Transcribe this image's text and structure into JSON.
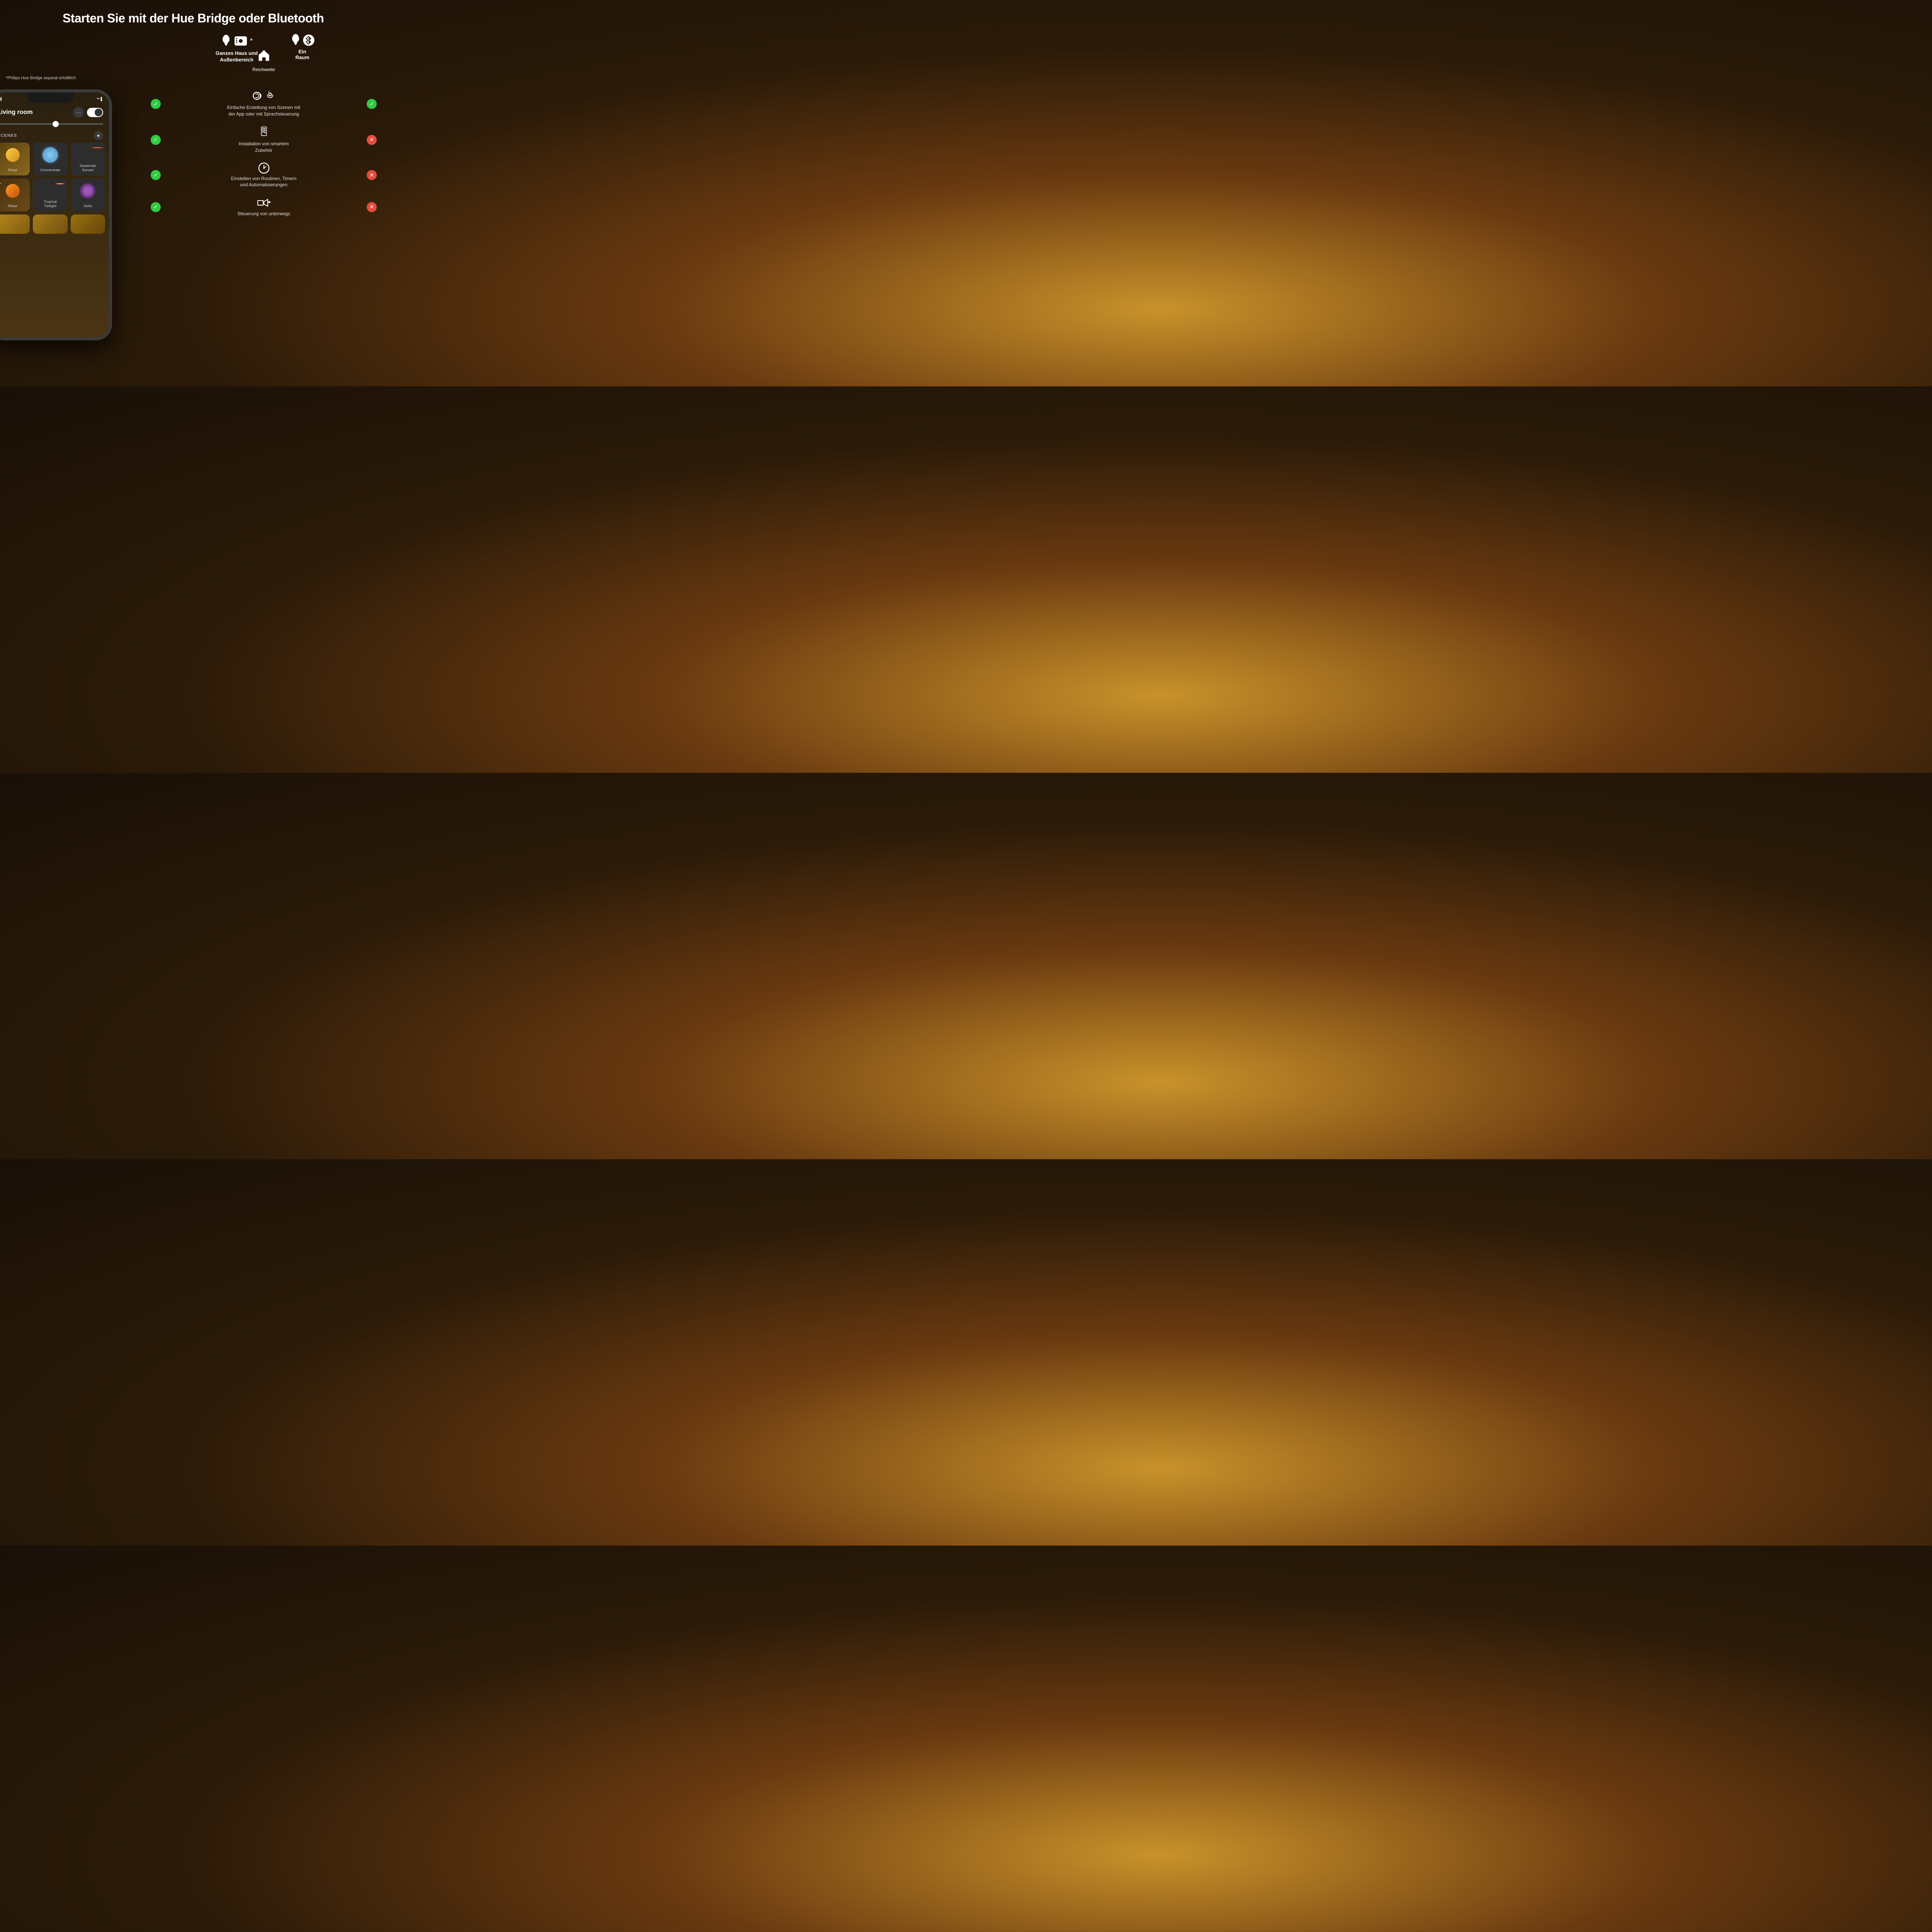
{
  "page": {
    "title": "Starten Sie mit der Hue Bridge oder Bluetooth",
    "background": "dark-warm-gradient"
  },
  "bridge_section": {
    "lamp_asterisk": "*",
    "label_line1": "Ganzes Haus und",
    "label_line2": "Außenbereich"
  },
  "range_section": {
    "label": "Reichweite"
  },
  "bluetooth_section": {
    "label_line1": "Ein",
    "label_line2": "Raum"
  },
  "phone_note": "*Philips Hue Bridge separat erhältlich",
  "app": {
    "room_name": "Living room",
    "dots_label": "•••",
    "scenes_header": "SCENES",
    "scenes": [
      {
        "id": "read",
        "label": "Read",
        "color_type": "warm-gold"
      },
      {
        "id": "concentrate",
        "label": "Concentrate",
        "color_type": "cyan-rings"
      },
      {
        "id": "savannah-sunset",
        "label": "Savannah\nSunset",
        "color_type": "sunset"
      },
      {
        "id": "relax",
        "label": "Relax",
        "color_type": "warm-orange"
      },
      {
        "id": "tropical-twilight",
        "label": "Tropical\nTwilight",
        "color_type": "tropical"
      },
      {
        "id": "soho",
        "label": "Soho",
        "color_type": "soho"
      }
    ]
  },
  "features": [
    {
      "id": "scenes",
      "icon": "voice-nfc",
      "text": "Einfache Erstellung von Szenen mit\nder App oder mit Sprachsteuerung",
      "bridge_supported": true,
      "bt_supported": true
    },
    {
      "id": "accessories",
      "icon": "smart-accessory",
      "text": "Installation von smartem\nZubehör",
      "bridge_supported": true,
      "bt_supported": false
    },
    {
      "id": "routines",
      "icon": "clock",
      "text": "Einstellen von Routinen, Timern\nund Automatisierungen",
      "bridge_supported": true,
      "bt_supported": false
    },
    {
      "id": "remote",
      "icon": "remote-control",
      "text": "Steuerung von unterwegs",
      "bridge_supported": true,
      "bt_supported": false
    }
  ]
}
